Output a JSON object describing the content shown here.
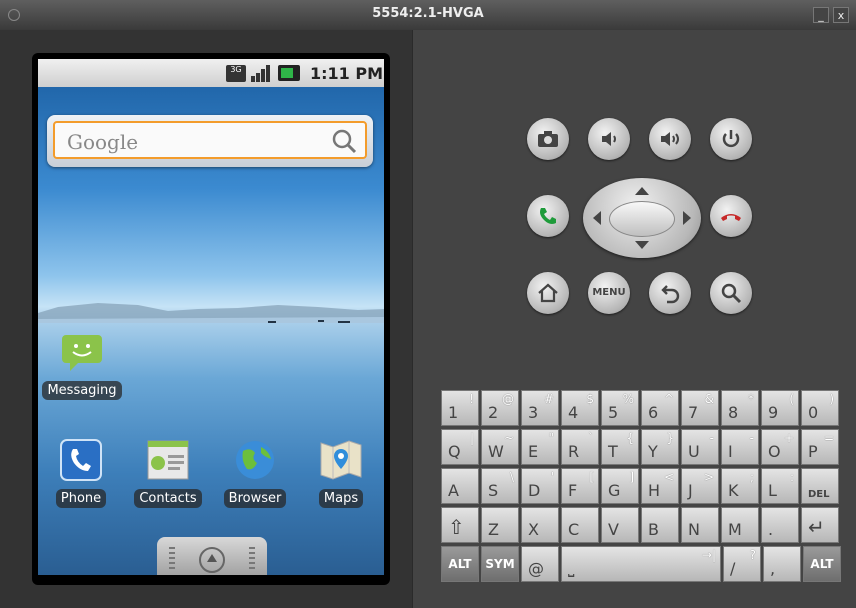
{
  "window": {
    "title": "5554:2.1-HVGA",
    "minimize_label": "_",
    "close_label": "x"
  },
  "status": {
    "network": "3G",
    "time": "1:11 PM"
  },
  "search": {
    "placeholder": "Google"
  },
  "apps": [
    {
      "label": "Messaging"
    },
    {
      "label": "Phone"
    },
    {
      "label": "Contacts"
    },
    {
      "label": "Browser"
    },
    {
      "label": "Maps"
    }
  ],
  "controls": {
    "menu_label": "MENU"
  },
  "keyboard": {
    "row1": [
      {
        "main": "1",
        "alt": "!"
      },
      {
        "main": "2",
        "alt": "@"
      },
      {
        "main": "3",
        "alt": "#"
      },
      {
        "main": "4",
        "alt": "$"
      },
      {
        "main": "5",
        "alt": "%"
      },
      {
        "main": "6",
        "alt": "^"
      },
      {
        "main": "7",
        "alt": "&"
      },
      {
        "main": "8",
        "alt": "*"
      },
      {
        "main": "9",
        "alt": "("
      },
      {
        "main": "0",
        "alt": ")"
      }
    ],
    "row2": [
      {
        "main": "Q",
        "alt": "|"
      },
      {
        "main": "W",
        "alt": "~"
      },
      {
        "main": "E",
        "alt": "\""
      },
      {
        "main": "R",
        "alt": "`"
      },
      {
        "main": "T",
        "alt": "{"
      },
      {
        "main": "Y",
        "alt": "}"
      },
      {
        "main": "U",
        "alt": "-"
      },
      {
        "main": "I",
        "alt": "-"
      },
      {
        "main": "O",
        "alt": "+"
      },
      {
        "main": "P",
        "alt": "="
      }
    ],
    "row3": [
      {
        "main": "A",
        "alt": ""
      },
      {
        "main": "S",
        "alt": "\\"
      },
      {
        "main": "D",
        "alt": "'"
      },
      {
        "main": "F",
        "alt": "["
      },
      {
        "main": "G",
        "alt": "]"
      },
      {
        "main": "H",
        "alt": "<"
      },
      {
        "main": "J",
        "alt": ">"
      },
      {
        "main": "K",
        "alt": ";"
      },
      {
        "main": "L",
        "alt": ":"
      },
      {
        "main": "DEL",
        "alt": ""
      }
    ],
    "row4": [
      {
        "main": "⇧",
        "alt": ""
      },
      {
        "main": "Z",
        "alt": ""
      },
      {
        "main": "X",
        "alt": ""
      },
      {
        "main": "C",
        "alt": ""
      },
      {
        "main": "V",
        "alt": ""
      },
      {
        "main": "B",
        "alt": ""
      },
      {
        "main": "N",
        "alt": ""
      },
      {
        "main": "M",
        "alt": ""
      },
      {
        "main": ".",
        "alt": ""
      },
      {
        "main": "↵",
        "alt": ""
      }
    ],
    "row5": [
      {
        "main": "ALT",
        "alt": ""
      },
      {
        "main": "SYM",
        "alt": ""
      },
      {
        "main": "@",
        "alt": ""
      },
      {
        "main": "⎵",
        "alt": "→|"
      },
      {
        "main": "/",
        "alt": "?"
      },
      {
        "main": ",",
        "alt": ""
      },
      {
        "main": "ALT",
        "alt": ""
      }
    ]
  }
}
